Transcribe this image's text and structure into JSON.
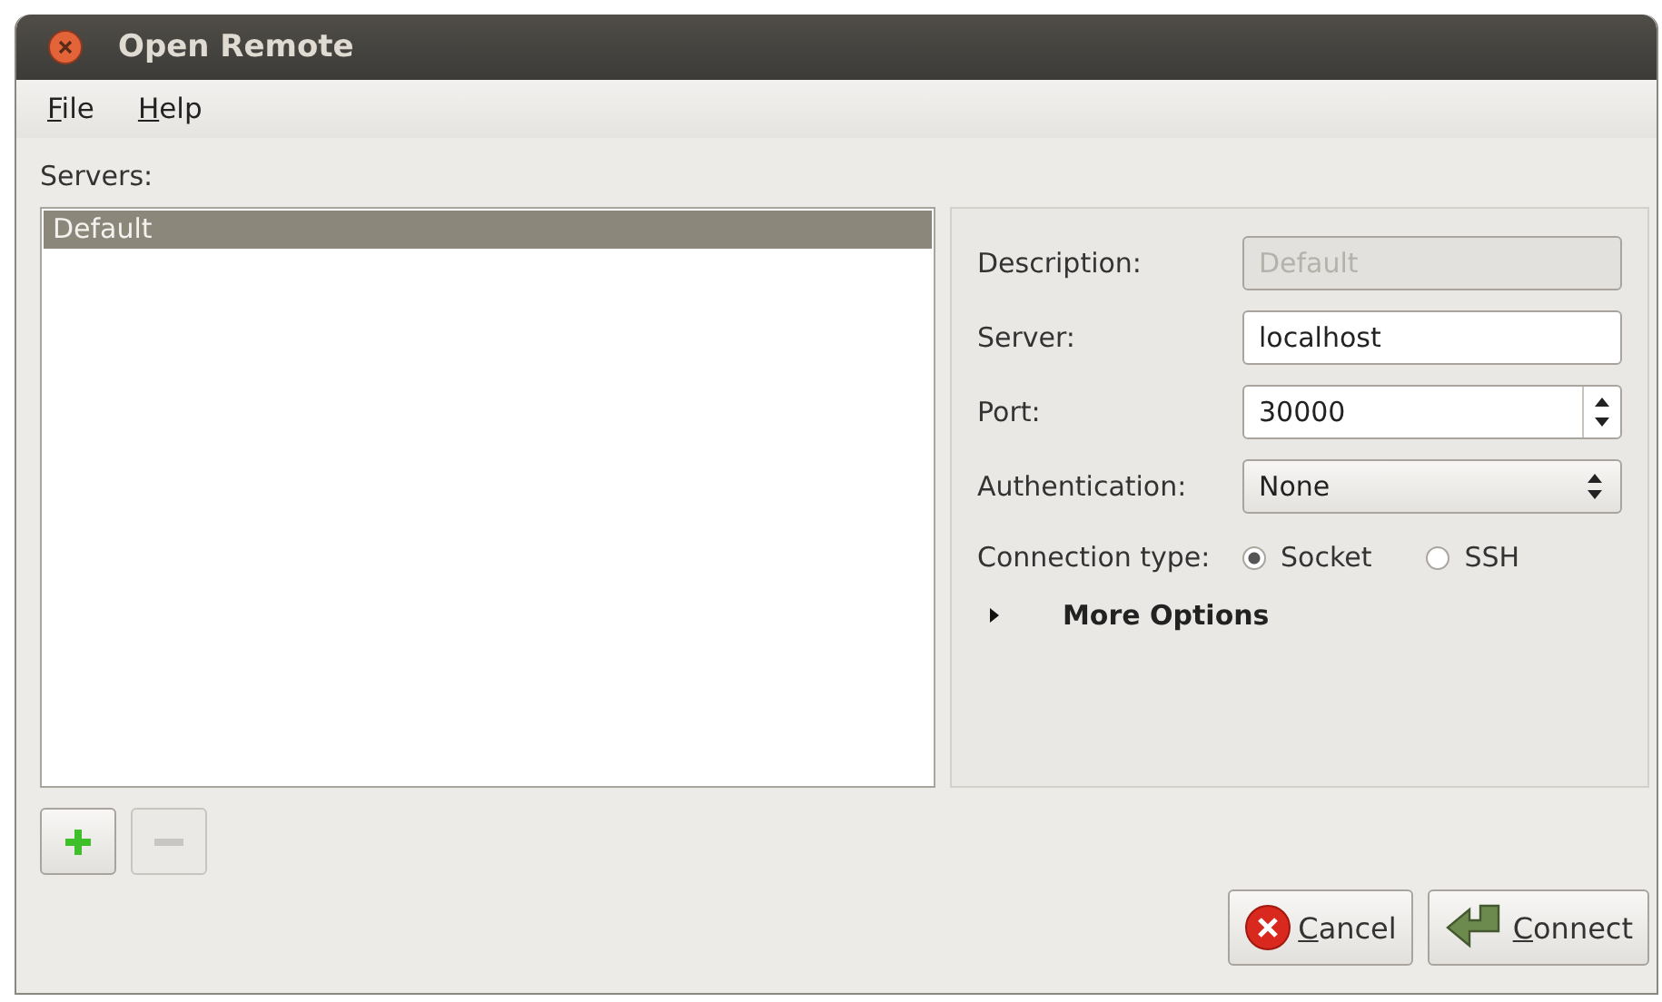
{
  "window": {
    "title": "Open Remote"
  },
  "menu": [
    {
      "label": "File"
    },
    {
      "label": "Help"
    }
  ],
  "servers": {
    "label": "Servers:",
    "items": [
      {
        "label": "Default",
        "selected": true
      }
    ]
  },
  "form": {
    "fields": [
      {
        "kind": "text",
        "label": "Description:",
        "value": "Default",
        "disabled": true
      },
      {
        "kind": "text",
        "label": "Server:",
        "value": "localhost",
        "disabled": false
      },
      {
        "kind": "spin",
        "label": "Port:",
        "value": "30000"
      },
      {
        "kind": "select",
        "label": "Authentication:",
        "value": "None"
      }
    ],
    "connection_type": {
      "label": "Connection type:",
      "options": [
        {
          "label": "Socket",
          "selected": true
        },
        {
          "label": "SSH",
          "selected": false
        }
      ]
    },
    "more_options": {
      "label": "More Options",
      "expanded": false
    }
  },
  "list_buttons": [
    {
      "kind": "add",
      "disabled": false
    },
    {
      "kind": "remove",
      "disabled": true
    }
  ],
  "buttons": [
    {
      "kind": "cancel",
      "label": "Cancel"
    },
    {
      "kind": "connect",
      "label": "Connect"
    }
  ]
}
